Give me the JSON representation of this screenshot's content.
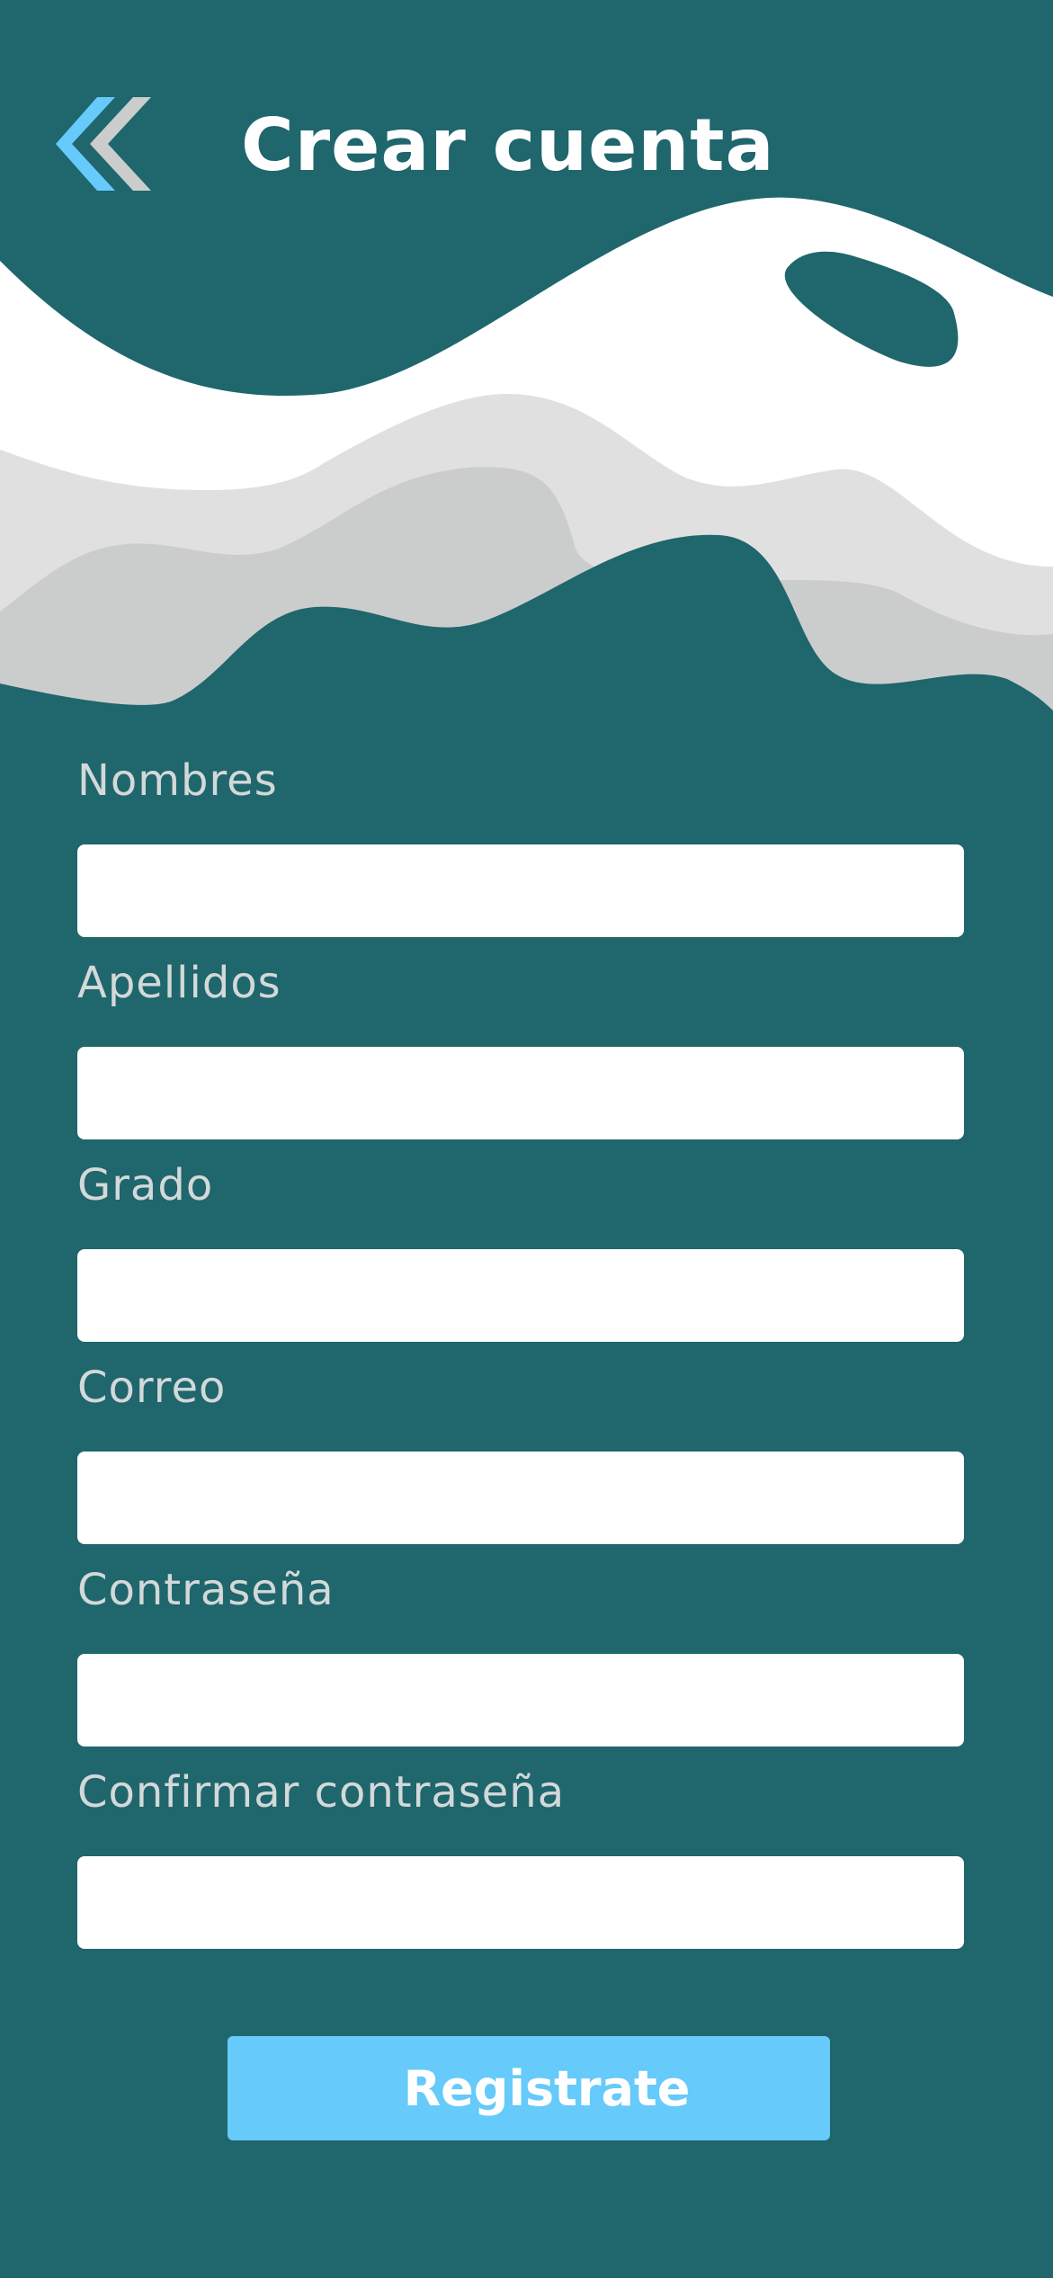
{
  "header": {
    "title": "Crear cuenta",
    "back_icon": "double-chevron-left-icon"
  },
  "colors": {
    "background": "#1F666D",
    "wave_white": "#FFFFFF",
    "wave_light_gray": "#E0E0E0",
    "wave_mid_gray": "#CBCDCC",
    "back_icon_blue": "#66CAFA",
    "back_icon_gray": "#CBCDCC",
    "label_text": "#D3D8D8",
    "input_background": "#FFFFFF",
    "button_background": "#66CAFA",
    "button_text": "#FFFFFF"
  },
  "form": {
    "fields": [
      {
        "label": "Nombres",
        "value": "",
        "placeholder": ""
      },
      {
        "label": "Apellidos",
        "value": "",
        "placeholder": ""
      },
      {
        "label": "Grado",
        "value": "",
        "placeholder": ""
      },
      {
        "label": "Correo",
        "value": "",
        "placeholder": ""
      },
      {
        "label": "Contraseña",
        "value": "",
        "placeholder": ""
      },
      {
        "label": "Confirmar contraseña",
        "value": "",
        "placeholder": ""
      }
    ],
    "submit_label": "Registrate"
  }
}
